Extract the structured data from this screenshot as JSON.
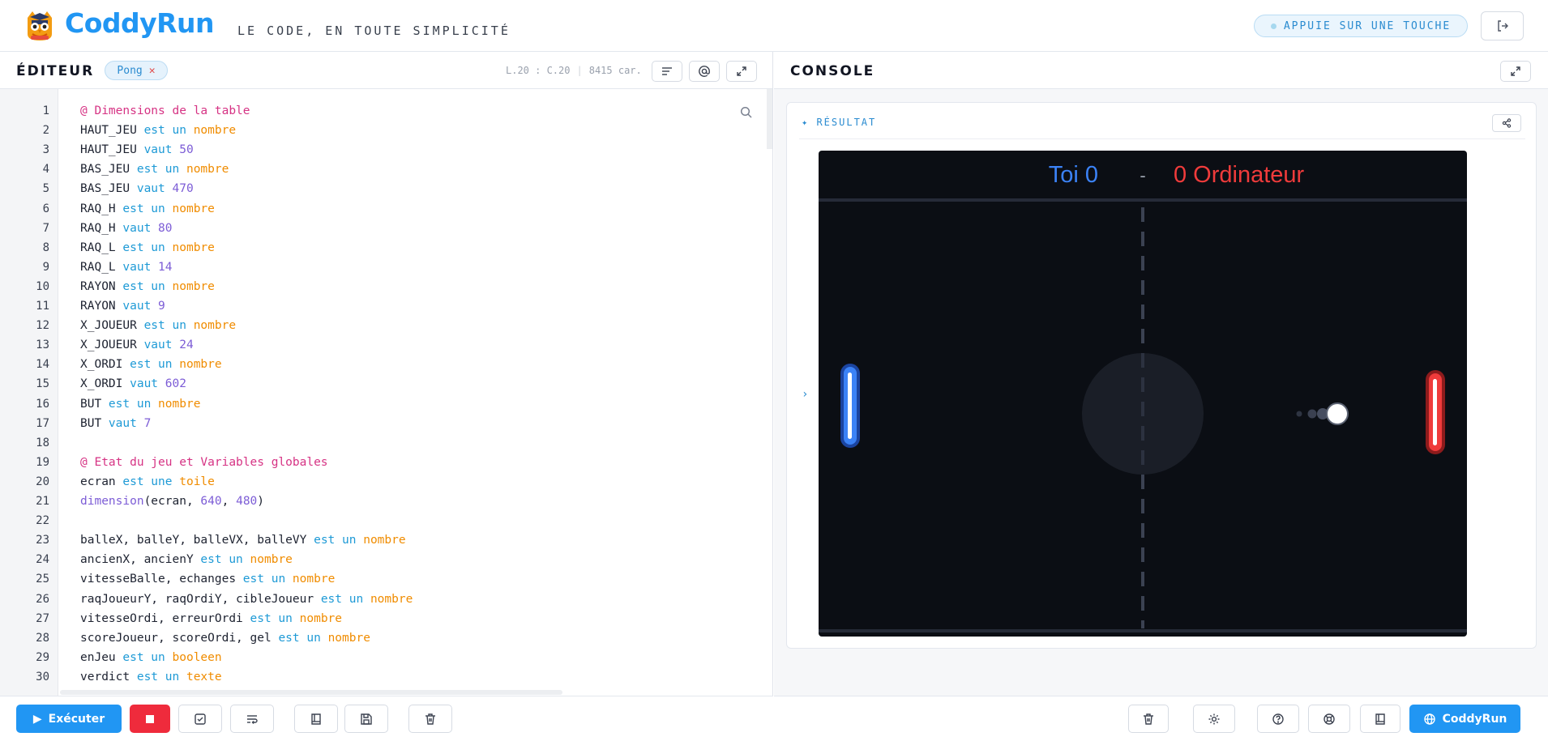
{
  "header": {
    "brand": "CoddyRun",
    "tagline": "LE CODE, EN TOUTE SIMPLICITÉ",
    "status": "APPUIE SUR UNE TOUCHE",
    "logout_icon": "logout-icon"
  },
  "editor": {
    "title": "ÉDITEUR",
    "file_tab": "Pong",
    "cursor_line": "L.20 : C.20",
    "char_count": "8415 car.",
    "icons": [
      "format-icon",
      "at-sign-icon",
      "expand-icon",
      "search-icon"
    ],
    "lines": [
      {
        "n": "1",
        "parts": [
          [
            "@ Dimensions de la table",
            "comment"
          ]
        ]
      },
      {
        "n": "2",
        "parts": [
          [
            "HAUT_JEU ",
            ""
          ],
          [
            "est un",
            "kw"
          ],
          [
            " ",
            ""
          ],
          [
            "nombre",
            "type"
          ]
        ]
      },
      {
        "n": "3",
        "parts": [
          [
            "HAUT_JEU ",
            ""
          ],
          [
            "vaut",
            "kw"
          ],
          [
            " ",
            ""
          ],
          [
            "50",
            "num"
          ]
        ]
      },
      {
        "n": "4",
        "parts": [
          [
            "BAS_JEU ",
            ""
          ],
          [
            "est un",
            "kw"
          ],
          [
            " ",
            ""
          ],
          [
            "nombre",
            "type"
          ]
        ]
      },
      {
        "n": "5",
        "parts": [
          [
            "BAS_JEU ",
            ""
          ],
          [
            "vaut",
            "kw"
          ],
          [
            " ",
            ""
          ],
          [
            "470",
            "num"
          ]
        ]
      },
      {
        "n": "6",
        "parts": [
          [
            "RAQ_H ",
            ""
          ],
          [
            "est un",
            "kw"
          ],
          [
            " ",
            ""
          ],
          [
            "nombre",
            "type"
          ]
        ]
      },
      {
        "n": "7",
        "parts": [
          [
            "RAQ_H ",
            ""
          ],
          [
            "vaut",
            "kw"
          ],
          [
            " ",
            ""
          ],
          [
            "80",
            "num"
          ]
        ]
      },
      {
        "n": "8",
        "parts": [
          [
            "RAQ_L ",
            ""
          ],
          [
            "est un",
            "kw"
          ],
          [
            " ",
            ""
          ],
          [
            "nombre",
            "type"
          ]
        ]
      },
      {
        "n": "9",
        "parts": [
          [
            "RAQ_L ",
            ""
          ],
          [
            "vaut",
            "kw"
          ],
          [
            " ",
            ""
          ],
          [
            "14",
            "num"
          ]
        ]
      },
      {
        "n": "10",
        "parts": [
          [
            "RAYON ",
            ""
          ],
          [
            "est un",
            "kw"
          ],
          [
            " ",
            ""
          ],
          [
            "nombre",
            "type"
          ]
        ]
      },
      {
        "n": "11",
        "parts": [
          [
            "RAYON ",
            ""
          ],
          [
            "vaut",
            "kw"
          ],
          [
            " ",
            ""
          ],
          [
            "9",
            "num"
          ]
        ]
      },
      {
        "n": "12",
        "parts": [
          [
            "X_JOUEUR ",
            ""
          ],
          [
            "est un",
            "kw"
          ],
          [
            " ",
            ""
          ],
          [
            "nombre",
            "type"
          ]
        ]
      },
      {
        "n": "13",
        "parts": [
          [
            "X_JOUEUR ",
            ""
          ],
          [
            "vaut",
            "kw"
          ],
          [
            " ",
            ""
          ],
          [
            "24",
            "num"
          ]
        ]
      },
      {
        "n": "14",
        "parts": [
          [
            "X_ORDI ",
            ""
          ],
          [
            "est un",
            "kw"
          ],
          [
            " ",
            ""
          ],
          [
            "nombre",
            "type"
          ]
        ]
      },
      {
        "n": "15",
        "parts": [
          [
            "X_ORDI ",
            ""
          ],
          [
            "vaut",
            "kw"
          ],
          [
            " ",
            ""
          ],
          [
            "602",
            "num"
          ]
        ]
      },
      {
        "n": "16",
        "parts": [
          [
            "BUT ",
            ""
          ],
          [
            "est un",
            "kw"
          ],
          [
            " ",
            ""
          ],
          [
            "nombre",
            "type"
          ]
        ]
      },
      {
        "n": "17",
        "parts": [
          [
            "BUT ",
            ""
          ],
          [
            "vaut",
            "kw"
          ],
          [
            " ",
            ""
          ],
          [
            "7",
            "num"
          ]
        ]
      },
      {
        "n": "18",
        "parts": []
      },
      {
        "n": "19",
        "parts": [
          [
            "@ Etat du jeu et Variables globales",
            "comment"
          ]
        ]
      },
      {
        "n": "20",
        "parts": [
          [
            "ecran ",
            ""
          ],
          [
            "est une",
            "kw"
          ],
          [
            " ",
            ""
          ],
          [
            "toile",
            "type"
          ]
        ]
      },
      {
        "n": "21",
        "parts": [
          [
            "dimension",
            "fn"
          ],
          [
            "(ecran, ",
            ""
          ],
          [
            "640",
            "num"
          ],
          [
            ", ",
            ""
          ],
          [
            "480",
            "num"
          ],
          [
            ")",
            ""
          ]
        ]
      },
      {
        "n": "22",
        "parts": []
      },
      {
        "n": "23",
        "parts": [
          [
            "balleX, balleY, balleVX, balleVY ",
            ""
          ],
          [
            "est un",
            "kw"
          ],
          [
            " ",
            ""
          ],
          [
            "nombre",
            "type"
          ]
        ]
      },
      {
        "n": "24",
        "parts": [
          [
            "ancienX, ancienY ",
            ""
          ],
          [
            "est un",
            "kw"
          ],
          [
            " ",
            ""
          ],
          [
            "nombre",
            "type"
          ]
        ]
      },
      {
        "n": "25",
        "parts": [
          [
            "vitesseBalle, echanges ",
            ""
          ],
          [
            "est un",
            "kw"
          ],
          [
            " ",
            ""
          ],
          [
            "nombre",
            "type"
          ]
        ]
      },
      {
        "n": "26",
        "parts": [
          [
            "raqJoueurY, raqOrdiY, cibleJoueur ",
            ""
          ],
          [
            "est un",
            "kw"
          ],
          [
            " ",
            ""
          ],
          [
            "nombre",
            "type"
          ]
        ]
      },
      {
        "n": "27",
        "parts": [
          [
            "vitesseOrdi, erreurOrdi ",
            ""
          ],
          [
            "est un",
            "kw"
          ],
          [
            " ",
            ""
          ],
          [
            "nombre",
            "type"
          ]
        ]
      },
      {
        "n": "28",
        "parts": [
          [
            "scoreJoueur, scoreOrdi, gel ",
            ""
          ],
          [
            "est un",
            "kw"
          ],
          [
            " ",
            ""
          ],
          [
            "nombre",
            "type"
          ]
        ]
      },
      {
        "n": "29",
        "parts": [
          [
            "enJeu ",
            ""
          ],
          [
            "est un",
            "kw"
          ],
          [
            " ",
            ""
          ],
          [
            "booleen",
            "type"
          ]
        ]
      },
      {
        "n": "30",
        "parts": [
          [
            "verdict ",
            ""
          ],
          [
            "est un",
            "kw"
          ],
          [
            " ",
            ""
          ],
          [
            "texte",
            "type"
          ]
        ]
      }
    ],
    "footer": {
      "run_label": "Exécuter",
      "tool_icons": [
        "stop-icon",
        "check-icon",
        "wrap-icon",
        "book-icon",
        "save-icon",
        "trash-icon"
      ]
    }
  },
  "console": {
    "title": "CONSOLE",
    "result_label": "✦ RÉSULTAT",
    "prompt": "›",
    "game": {
      "player_label": "Toi 0",
      "separator": "-",
      "cpu_label": "0 Ordinateur",
      "player_color": "#3b82f6",
      "cpu_color": "#ef3b3b",
      "background": "#0b0e14"
    },
    "footer": {
      "brand_label": "CoddyRun",
      "tool_icons": [
        "trash-icon",
        "gear-icon",
        "help-icon",
        "lifebuoy-icon",
        "book-icon",
        "globe-icon"
      ]
    }
  }
}
